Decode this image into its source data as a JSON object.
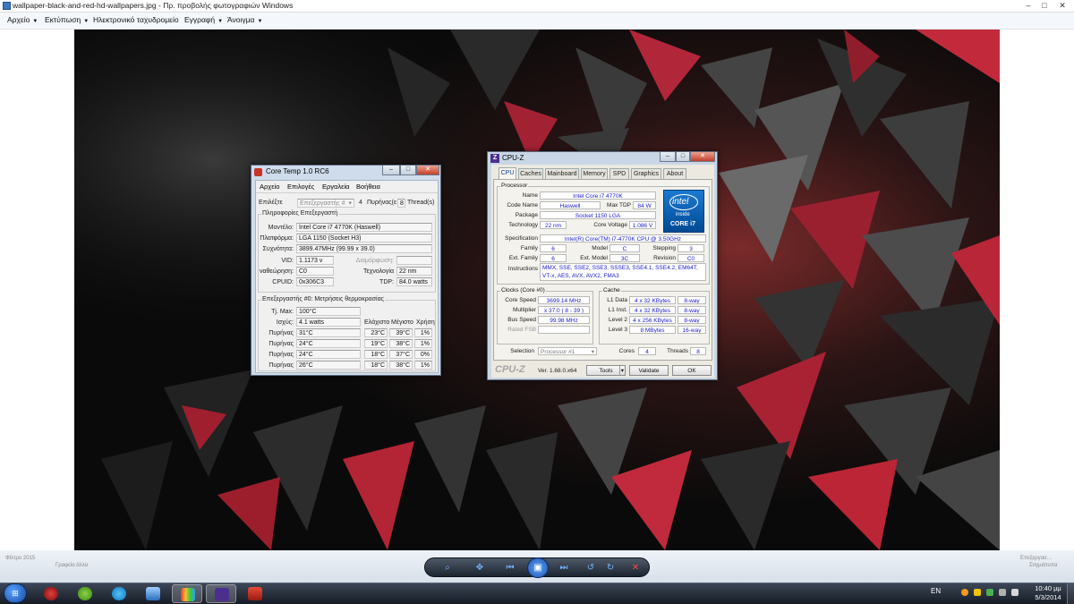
{
  "viewer": {
    "title": "wallpaper-black-and-red-hd-wallpapers.jpg - Πρ. προβολής φωτογραφιών Windows",
    "menu": [
      {
        "label": "Αρχείο",
        "arrow": "▼"
      },
      {
        "label": "Εκτύπωση",
        "arrow": "▼"
      },
      {
        "label": "Ηλεκτρονικό ταχυδρομείο",
        "arrow": ""
      },
      {
        "label": "Εγγραφή",
        "arrow": "▼"
      },
      {
        "label": "Άνοιγμα",
        "arrow": "▼"
      }
    ],
    "bottom_left": "Φίλτρο 2015",
    "bottom_left2": "Γραφεία άλλα",
    "bottom_right": "Επεξεργασ...",
    "bottom_right2": "Στιγμιότυπα"
  },
  "coretemp": {
    "title": "Core Temp 1.0 RC6",
    "menu": [
      "Αρχείο",
      "Επιλογές",
      "Εργαλεία",
      "Βοήθεια"
    ],
    "select_label": "Επιλέξτε",
    "select_value": "Επεξεργαστής #",
    "cores_value": "4",
    "cores_label": "Πυρήνας(ε",
    "threads_value": "8",
    "threads_label": "Thread(s)",
    "info_group": "Πληροφορίες Επεξεργαστή",
    "model_label": "Μοντέλο:",
    "model": "Intel Core i7 4770K (Haswell)",
    "platform_label": "Πλατφόρμα:",
    "platform": "LGA 1150 (Socket H3)",
    "freq_label": "Συχνότητα:",
    "freq": "3899.47MHz (99.99 x 39.0)",
    "vid_label": "VID:",
    "vid": "1.1173 v",
    "modulation_label": "Διαμόρφωση:",
    "revision_label": "ναθεώρηση:",
    "revision": "C0",
    "lithography_label": "Τεχνολογία",
    "lithography": "22 nm",
    "cpuid_label": "CPUID:",
    "cpuid": "0x306C3",
    "tdp_label": "TDP:",
    "tdp": "84.0 watts",
    "temp_group": "Επεξεργαστής #0: Μετρήσεις θερμοκρασίας",
    "tjmax_label": "Tj. Max:",
    "tjmax": "100°C",
    "power_label": "Ισχύς:",
    "power": "4.1 watts",
    "col_min": "Ελάχιστο",
    "col_max": "Μέγιστο",
    "col_load": "Χρήση",
    "cores": [
      {
        "label": "Πυρήνας",
        "temp": "31°C",
        "min": "23°C",
        "max": "39°C",
        "load": "1%"
      },
      {
        "label": "Πυρήνας",
        "temp": "24°C",
        "min": "19°C",
        "max": "38°C",
        "load": "1%"
      },
      {
        "label": "Πυρήνας",
        "temp": "24°C",
        "min": "18°C",
        "max": "37°C",
        "load": "0%"
      },
      {
        "label": "Πυρήνας",
        "temp": "26°C",
        "min": "18°C",
        "max": "38°C",
        "load": "1%"
      }
    ]
  },
  "cpuz": {
    "title": "CPU-Z",
    "tabs": [
      "CPU",
      "Caches",
      "Mainboard",
      "Memory",
      "SPD",
      "Graphics",
      "About"
    ],
    "processor_group": "Processor",
    "name_label": "Name",
    "name": "Intel Core i7 4770K",
    "codename_label": "Code Name",
    "codename": "Haswell",
    "maxtdp_label": "Max TDP",
    "maxtdp": "84 W",
    "package_label": "Package",
    "package": "Socket 1150 LGA",
    "technology_label": "Technology",
    "technology": "22 nm",
    "corevoltage_label": "Core Voltage",
    "corevoltage": "1.086 V",
    "spec_label": "Specification",
    "spec": "Intel(R) Core(TM) i7-4770K CPU @ 3.50GHz",
    "family_label": "Family",
    "family": "6",
    "model_label": "Model",
    "model": "C",
    "stepping_label": "Stepping",
    "stepping": "3",
    "extfamily_label": "Ext. Family",
    "extfamily": "6",
    "extmodel_label": "Ext. Model",
    "extmodel": "3C",
    "revision_label": "Revision",
    "revision": "C0",
    "instructions_label": "Instructions",
    "instructions_1": "MMX, SSE, SSE2, SSE3, SSSE3, SSE4.1, SSE4.2, EM64T,",
    "instructions_2": "VT-x, AES, AVX, AVX2, FMA3",
    "clocks_group": "Clocks (Core #0)",
    "corespeed_label": "Core Speed",
    "corespeed": "3699.14 MHz",
    "multiplier_label": "Multiplier",
    "multiplier": "x 37.0 ( 8 - 39 )",
    "busspeed_label": "Bus Speed",
    "busspeed": "99.98 MHz",
    "ratedfsb_label": "Rated FSB",
    "cache_group": "Cache",
    "l1d_label": "L1 Data",
    "l1d": "4 x 32 KBytes",
    "l1d_way": "8-way",
    "l1i_label": "L1 Inst.",
    "l1i": "4 x 32 KBytes",
    "l1i_way": "8-way",
    "l2_label": "Level 2",
    "l2": "4 x 256 KBytes",
    "l2_way": "8-way",
    "l3_label": "Level 3",
    "l3": "8 MBytes",
    "l3_way": "16-way",
    "selection_label": "Selection",
    "selection": "Processor #1",
    "cores_label": "Cores",
    "cores": "4",
    "threads_label": "Threads",
    "threads": "8",
    "brand": "CPU-Z",
    "version": "Ver. 1.68.0.x64",
    "tools_label": "Tools",
    "validate_label": "Validate",
    "ok_label": "OK",
    "badge_brand": "intel",
    "badge_line1": "inside",
    "badge_line2": "CORE i7"
  },
  "taskbar": {
    "lang": "EN",
    "time": "10:40 μμ",
    "date": "5/3/2014"
  },
  "colors": {
    "intel_blue": "#0068b5",
    "cpuz_value": "#1a1ad0",
    "coretemp_title": "#cfdcec"
  }
}
